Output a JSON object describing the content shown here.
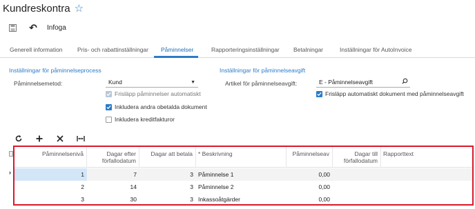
{
  "header": {
    "title": "Kundreskontra"
  },
  "toolbar": {
    "insert_label": "Infoga"
  },
  "tabs": [
    {
      "label": "Generell information"
    },
    {
      "label": "Pris- och rabattinställningar"
    },
    {
      "label": "Påminnelser",
      "active": true
    },
    {
      "label": "Rapporteringsinställningar"
    },
    {
      "label": "Betalningar"
    },
    {
      "label": "Inställningar för AutoInvoice"
    }
  ],
  "process_section": {
    "title": "Inställningar för påminnelseprocess",
    "method_label": "Påminnelsemetod:",
    "method_value": "Kund",
    "auto_release_label": "Frisläpp påminnelser automatiskt",
    "include_other_label": "Inkludera andra obetalda dokument",
    "include_credit_label": "Inkludera kreditfakturor"
  },
  "fee_section": {
    "title": "Inställningar för påminnelseavgift",
    "article_label": "Artikel för påminnelseavgift:",
    "article_value": "E - Påminnelseavgift",
    "auto_release_doc_label": "Frisläpp automatiskt dokument med påminnelseavgift"
  },
  "grid": {
    "columns": {
      "level": "Påminnelsenivå",
      "days_after_l1": "Dagar efter",
      "days_after_l2": "förfallodatum",
      "days_to_pay": "Dagar att betala",
      "description": "* Beskrivning",
      "fee": "Påminnelseav",
      "days_until_l1": "Dagar till",
      "days_until_l2": "förfallodatum",
      "report_text": "Rapporttext"
    },
    "rows": [
      {
        "level": "1",
        "days_after": "7",
        "days_to_pay": "3",
        "description": "Påminnelse 1",
        "fee": "0,00"
      },
      {
        "level": "2",
        "days_after": "14",
        "days_to_pay": "3",
        "description": "Påminnelse 2",
        "fee": "0,00"
      },
      {
        "level": "3",
        "days_after": "30",
        "days_to_pay": "3",
        "description": "Inkassoåtgärder",
        "fee": "0,00"
      }
    ]
  },
  "colors": {
    "accent": "#2b7bc8",
    "highlight_outline": "#d8182a",
    "selected_row": "#d3e6f8"
  }
}
